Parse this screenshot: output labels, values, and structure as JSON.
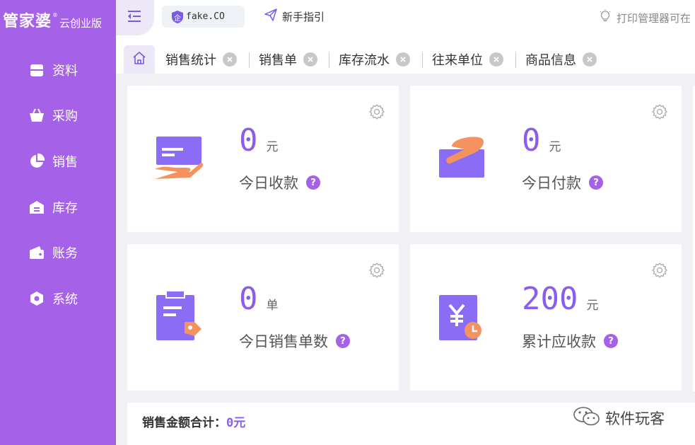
{
  "sidebar": {
    "logo": {
      "main": "管家婆",
      "registered": "®",
      "sub": "云创业版"
    },
    "items": [
      {
        "label": "资料",
        "icon": "profile-folder-icon"
      },
      {
        "label": "采购",
        "icon": "basket-icon"
      },
      {
        "label": "销售",
        "icon": "pie-chart-icon"
      },
      {
        "label": "库存",
        "icon": "warehouse-icon"
      },
      {
        "label": "账务",
        "icon": "wallet-icon"
      },
      {
        "label": "系统",
        "icon": "hexagon-settings-icon"
      }
    ]
  },
  "topbar": {
    "company": {
      "badge": "企",
      "name": "fake.CO"
    },
    "guide": "新手指引",
    "print_notice": "打印管理器可在"
  },
  "tabs": [
    {
      "label": "销售统计"
    },
    {
      "label": "销售单"
    },
    {
      "label": "库存流水"
    },
    {
      "label": "往来单位"
    },
    {
      "label": "商品信息"
    }
  ],
  "cards": [
    {
      "value": "0",
      "unit": "元",
      "label": "今日收款",
      "help": "?"
    },
    {
      "value": "0",
      "unit": "元",
      "label": "今日付款",
      "help": "?"
    },
    {
      "value": "0",
      "unit": "单",
      "label": "今日销售单数",
      "help": "?"
    },
    {
      "value": "200",
      "unit": "元",
      "label": "累计应收款",
      "help": "?"
    }
  ],
  "summary": {
    "label": "销售金额合计：",
    "value": "0元"
  },
  "watermark": {
    "text": "软件玩客"
  },
  "colors": {
    "primary": "#a561e8",
    "value": "#8a5cf0",
    "accent_orange": "#f4935f",
    "card_purple": "#8a6cf5"
  }
}
